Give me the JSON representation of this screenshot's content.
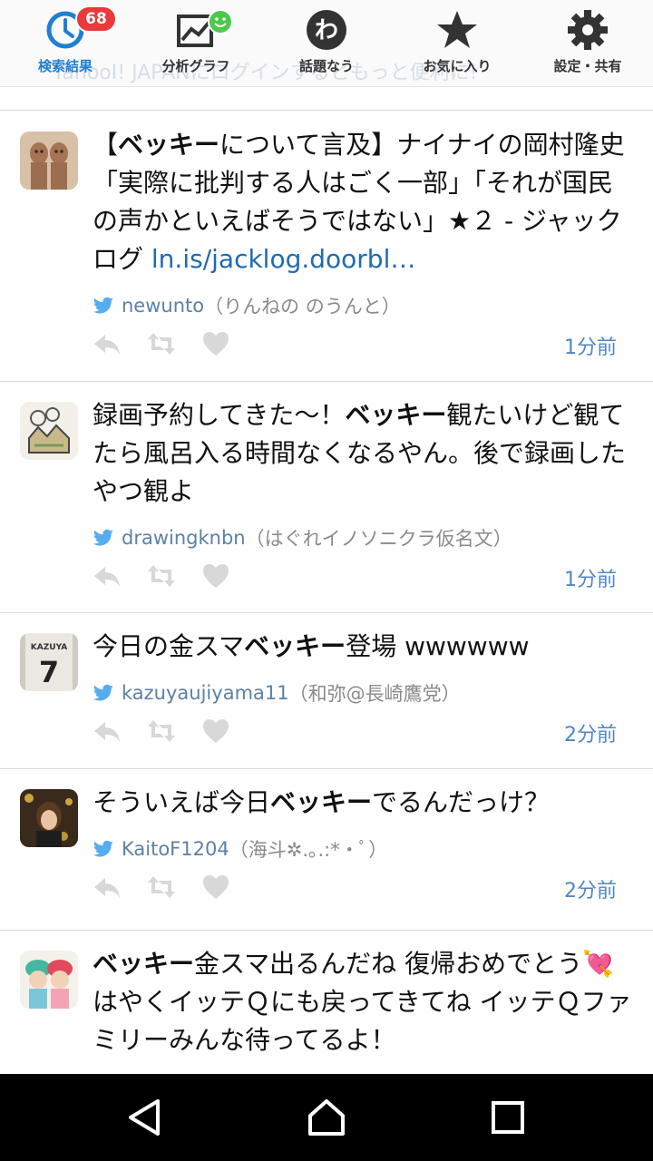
{
  "topbar": {
    "ghost_text": "YahooI! JAPANにログインするともっと便利に!",
    "tabs": [
      {
        "label": "検索結果",
        "badge": "68",
        "icon": "clock-icon",
        "active": true
      },
      {
        "label": "分析グラフ",
        "icon": "chart-icon"
      },
      {
        "label": "話題なう",
        "icon": "wa-icon",
        "icon_char": "わ"
      },
      {
        "label": "お気に入り",
        "icon": "star-icon"
      },
      {
        "label": "設定・共有",
        "icon": "gear-icon"
      }
    ]
  },
  "tweets": [
    {
      "text_parts": [
        "【",
        "ベッキー",
        "について言及】ナイナイの岡村隆史「実際に批判する人はごく一部」「それが国民の声かといえばそうではない」★２ - ジャックログ "
      ],
      "link": "ln.is/jacklog.doorbl…",
      "handle": "newunto",
      "display_name": "（りんねの のうんと）",
      "time": "1分前"
    },
    {
      "text_parts": [
        "録画予約してきた～！",
        "ベッキー",
        "観たいけど観てたら風呂入る時間なくなるやん。後で録画したやつ観よ"
      ],
      "handle": "drawingknbn",
      "display_name": "（はぐれイノソニクラ仮名文）",
      "time": "1分前"
    },
    {
      "text_parts": [
        "今日の金スマ",
        "ベッキー",
        "登場 wwwwww"
      ],
      "handle": "kazuyaujiyama11",
      "display_name": "（和弥@長崎鷹党）",
      "time": "2分前",
      "avatar_text": "KAZUYA",
      "avatar_num": "7"
    },
    {
      "text_parts": [
        "そういえば今日",
        "ベッキー",
        "でるんだっけ？"
      ],
      "handle": "KaitoF1204",
      "display_name": "（海斗✲.｡.:*・ﾟ）",
      "time": "2分前"
    },
    {
      "text_parts": [
        "",
        "ベッキー",
        "金スマ出るんだね 復帰おめでとう💘 はやくイッテＱにも戻ってきてね イッテＱファミリーみんな待ってるよ！"
      ],
      "handle": "",
      "display_name": "",
      "time": ""
    }
  ],
  "colors": {
    "accent": "#1f7fd3",
    "badge": "#e8393b",
    "link": "#1f6ab4",
    "time": "#4f87c5",
    "twitter": "#55acee"
  }
}
